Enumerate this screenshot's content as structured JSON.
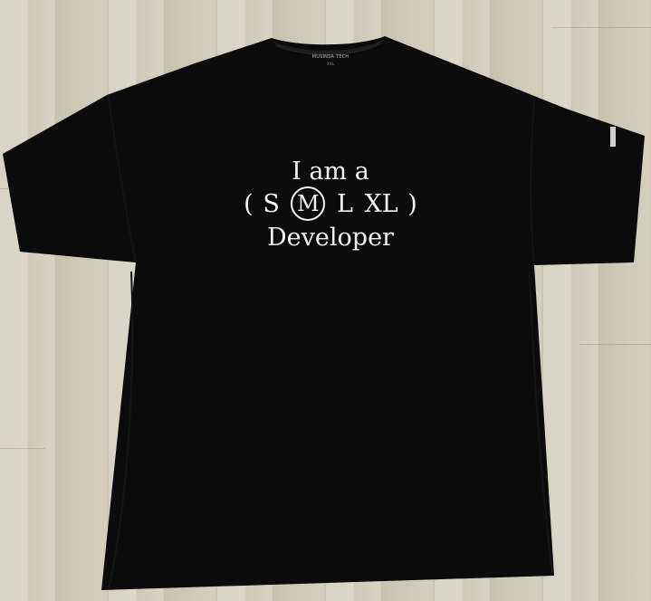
{
  "scene": {
    "background": "light wood floor",
    "shirt_color": "#0b0b0b",
    "print_color": "#f2f2f2",
    "floor_color": "#d5cebf"
  },
  "print": {
    "line1": "I am a",
    "open_paren": "(",
    "sizes": [
      "S",
      "M",
      "L",
      "XL"
    ],
    "selected_size": "M",
    "close_paren": ")",
    "line3": "Developer"
  },
  "neck_label": {
    "brand": "MUSINSA TECH",
    "size": "XXL"
  }
}
